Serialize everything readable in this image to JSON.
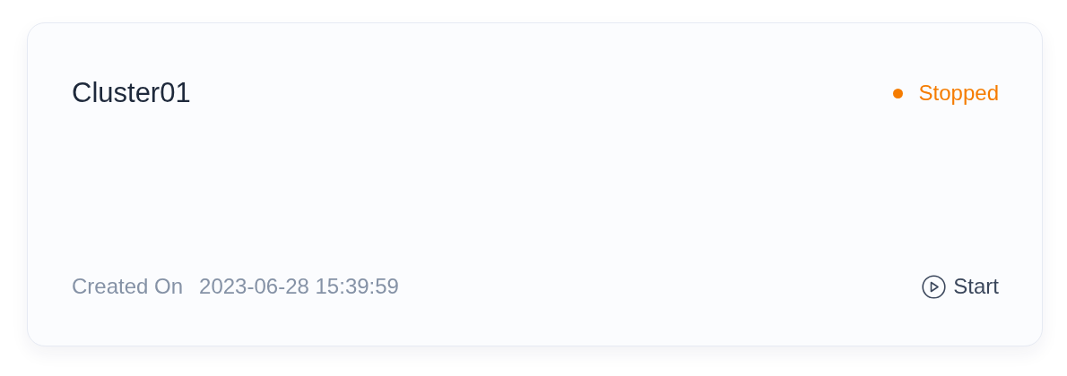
{
  "cluster": {
    "name": "Cluster01",
    "status": {
      "label": "Stopped",
      "color": "#f57c00"
    },
    "created_label": "Created On",
    "created_value": "2023-06-28 15:39:59",
    "action": {
      "label": "Start"
    }
  }
}
